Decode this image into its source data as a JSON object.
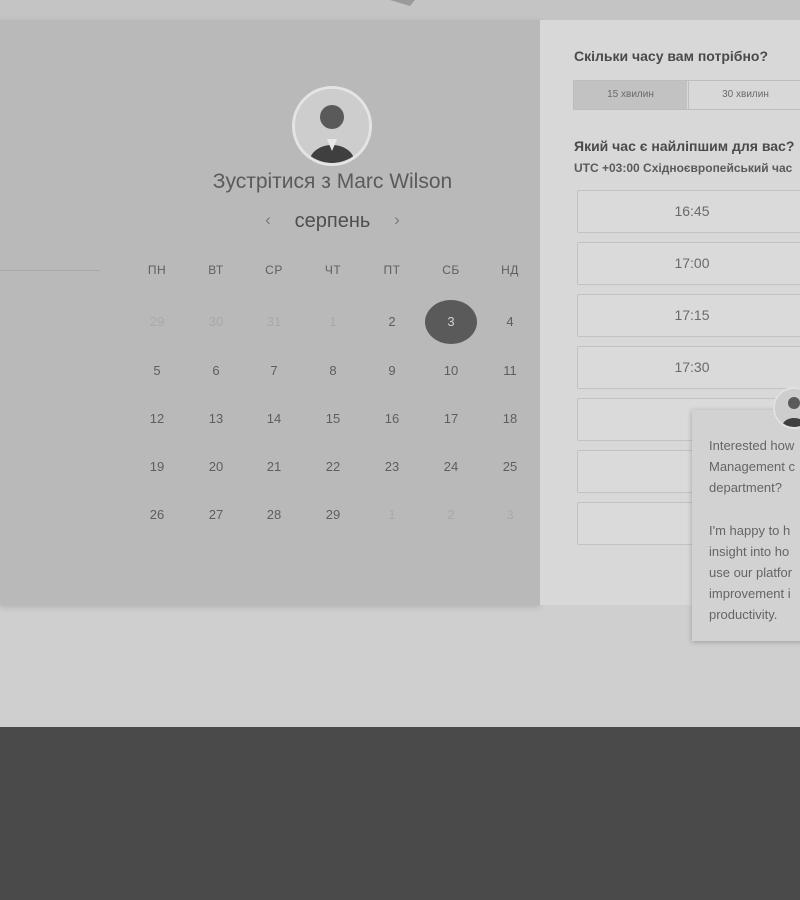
{
  "scheduler": {
    "title": "Зустрітися з Marc Wilson",
    "month_label": "серпень",
    "prev_arrow": "‹",
    "next_arrow": "›",
    "weekdays": [
      "ПН",
      "ВТ",
      "СР",
      "ЧТ",
      "ПТ",
      "СБ",
      "НД"
    ],
    "weeks": [
      [
        "29",
        "30",
        "31",
        "1",
        "2",
        "3",
        "4"
      ],
      [
        "5",
        "6",
        "7",
        "8",
        "9",
        "10",
        "11"
      ],
      [
        "12",
        "13",
        "14",
        "15",
        "16",
        "17",
        "18"
      ],
      [
        "19",
        "20",
        "21",
        "22",
        "23",
        "24",
        "25"
      ],
      [
        "26",
        "27",
        "28",
        "29",
        "1",
        "2",
        "3"
      ]
    ],
    "selected_day": "3"
  },
  "booking": {
    "duration_question": "Скільки часу вам потрібно?",
    "durations": [
      "15 хвилин",
      "30 хвилин"
    ],
    "time_question": "Який час є найліпшим для вас?",
    "timezone": "UTC +03:00 Східноєвропейський час",
    "slots": [
      "16:45",
      "17:00",
      "17:15",
      "17:30",
      "",
      "",
      ""
    ]
  },
  "chat": {
    "message_1": "Interested how\nManagement c\ndepartment?",
    "message_2": "I'm happy to h\ninsight into ho\nuse our platfor\nimprovement i\nproductivity."
  },
  "colors": {
    "selected_day_bg": "#5a5a5a",
    "footer_bg": "#4a4a4a"
  }
}
